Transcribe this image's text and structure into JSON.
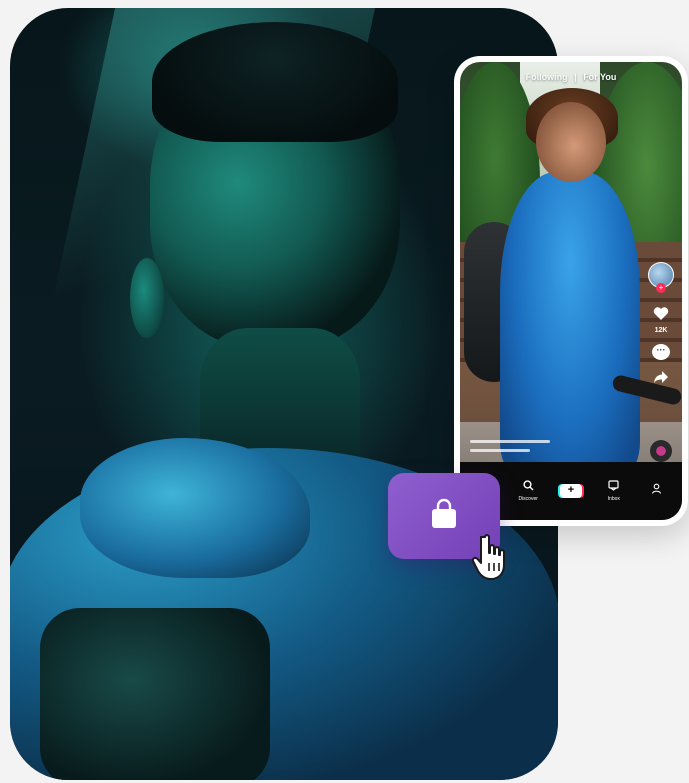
{
  "phone": {
    "top_tabs": {
      "following": "Following",
      "separator": "|",
      "for_you": "For You"
    },
    "side_actions": {
      "follow_plus": "+",
      "like_count": "12K"
    },
    "bottom_nav": {
      "home": "",
      "discover": "Discover",
      "create": "+",
      "inbox": "Inbox",
      "profile": ""
    }
  },
  "overlay": {
    "shop_button_icon": "shopping-bag-icon",
    "cursor_icon": "hand-pointer-icon"
  },
  "colors": {
    "shop_accent": "#8f5fcf",
    "tiktok_red": "#fe2c55",
    "tiktok_cyan": "#25f4ee"
  }
}
